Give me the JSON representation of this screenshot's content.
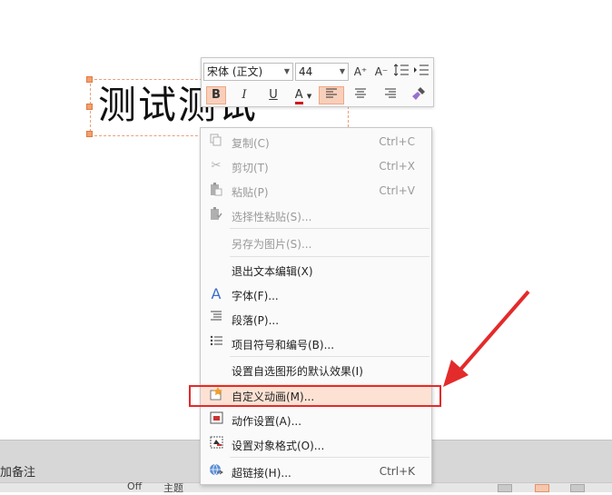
{
  "slide": {
    "text": "测试测试"
  },
  "mini_toolbar": {
    "font_name": "宋体 (正文)",
    "font_size": "44",
    "grow_font_icon": "A⁺",
    "shrink_font_icon": "A⁻",
    "bold": "B",
    "italic": "I",
    "underline": "U",
    "font_color": "A"
  },
  "context_menu": {
    "items": [
      {
        "label": "复制(C)",
        "shortcut": "Ctrl+C",
        "icon": "copy-icon"
      },
      {
        "label": "剪切(T)",
        "shortcut": "Ctrl+X",
        "icon": "scissors-icon"
      },
      {
        "label": "粘贴(P)",
        "shortcut": "Ctrl+V",
        "icon": "paste-icon"
      },
      {
        "label": "选择性粘贴(S)...",
        "shortcut": "",
        "icon": "paste-special-icon"
      },
      {
        "label": "另存为图片(S)...",
        "shortcut": "",
        "icon": ""
      },
      {
        "label": "退出文本编辑(X)",
        "shortcut": "",
        "icon": ""
      },
      {
        "label": "字体(F)...",
        "shortcut": "",
        "icon": "font-icon"
      },
      {
        "label": "段落(P)...",
        "shortcut": "",
        "icon": "paragraph-icon"
      },
      {
        "label": "项目符号和编号(B)...",
        "shortcut": "",
        "icon": "bullets-icon"
      },
      {
        "label": "设置自选图形的默认效果(I)",
        "shortcut": "",
        "icon": ""
      },
      {
        "label": "自定义动画(M)...",
        "shortcut": "",
        "icon": "custom-animation-icon"
      },
      {
        "label": "动作设置(A)...",
        "shortcut": "",
        "icon": "action-settings-icon"
      },
      {
        "label": "设置对象格式(O)...",
        "shortcut": "",
        "icon": "format-object-icon"
      },
      {
        "label": "超链接(H)...",
        "shortcut": "Ctrl+K",
        "icon": "hyperlink-icon"
      }
    ]
  },
  "notes": {
    "label": "加备注"
  },
  "status_bar": {
    "office_text": "Off",
    "theme_text": "主题"
  },
  "colors": {
    "highlight": "#fde2d4",
    "accent": "#f0a883",
    "annotation_red": "#e32b2b"
  }
}
